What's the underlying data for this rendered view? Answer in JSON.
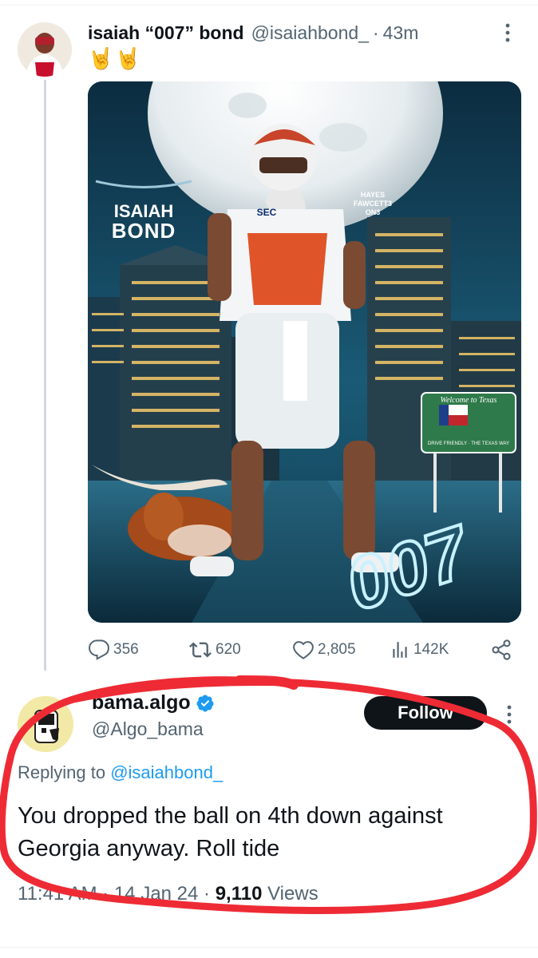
{
  "tweet": {
    "author_name": "isaiah “007” bond",
    "handle": "@isaiahbond_",
    "separator": "·",
    "time": "43m",
    "emoji_text": "🤘🤘",
    "media": {
      "top_label": "ISAIAH",
      "bottom_label": "BOND",
      "credit_lines": [
        "HAYES",
        "FAWCETT3",
        "ON3"
      ],
      "sign_title": "Welcome to Texas",
      "sign_footer": "DRIVE FRIENDLY · THE TEXAS WAY",
      "jersey_badge": "SEC",
      "number_neon": "007"
    },
    "actions": {
      "replies": "356",
      "retweets": "620",
      "likes": "2,805",
      "views": "142K"
    }
  },
  "reply": {
    "author_name": "bama.algo",
    "handle": "@Algo_bama",
    "follow_label": "Follow",
    "replying_prefix": "Replying to ",
    "replying_mention": "@isaiahbond_",
    "text_line1": "You dropped the ball on 4th down against",
    "text_line2": "Georgia anyway. Roll tide",
    "meta_time": "11:41 AM · 14 Jan 24 · ",
    "meta_views_num": "9,110",
    "meta_views_label": " Views"
  },
  "colors": {
    "link": "#1d9bf0",
    "text": "#0f1419",
    "muted": "#536471",
    "annotation": "#ee2b35"
  },
  "icons": [
    "more-icon",
    "reply-icon",
    "retweet-icon",
    "like-icon",
    "views-icon",
    "share-icon",
    "verified-icon"
  ]
}
